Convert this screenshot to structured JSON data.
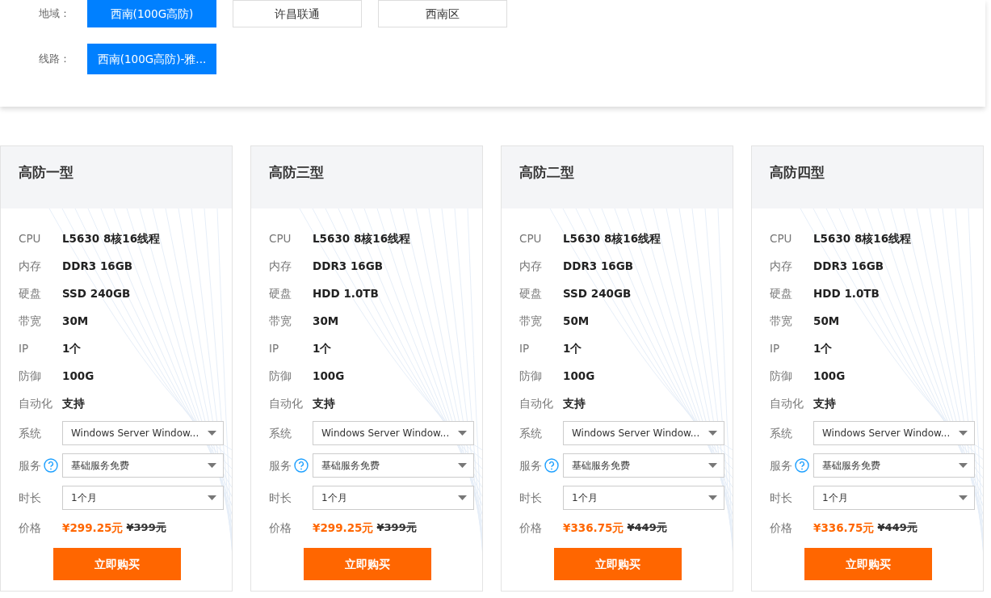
{
  "filters": [
    {
      "label": "地域：",
      "options": [
        {
          "text": "西南(100G高防)",
          "selected": true
        },
        {
          "text": "许昌联通",
          "selected": false
        },
        {
          "text": "西南区",
          "selected": false
        }
      ]
    },
    {
      "label": "线路：",
      "options": [
        {
          "text": "西南(100G高防)-雅...",
          "selected": true
        }
      ]
    }
  ],
  "plans": [
    {
      "title": "高防一型",
      "specs": [
        {
          "label": "CPU",
          "value": "L5630 8核16线程"
        },
        {
          "label": "内存",
          "value": "DDR3 16GB"
        },
        {
          "label": "硬盘",
          "value": "SSD 240GB"
        },
        {
          "label": "带宽",
          "value": "30M"
        },
        {
          "label": "IP",
          "value": "1个"
        },
        {
          "label": "防御",
          "value": "100G"
        },
        {
          "label": "自动化",
          "value": "支持"
        }
      ],
      "selects": [
        {
          "label": "系统",
          "value": "Windows Server Window...",
          "help": false
        },
        {
          "label": "服务",
          "value": "基础服务免费",
          "help": true
        },
        {
          "label": "时长",
          "value": "1个月",
          "help": false
        }
      ],
      "price_label": "价格",
      "price": "¥299.25元",
      "original_price": "¥399元",
      "buy": "立即购买"
    },
    {
      "title": "高防三型",
      "specs": [
        {
          "label": "CPU",
          "value": "L5630 8核16线程"
        },
        {
          "label": "内存",
          "value": "DDR3 16GB"
        },
        {
          "label": "硬盘",
          "value": "HDD 1.0TB"
        },
        {
          "label": "带宽",
          "value": "30M"
        },
        {
          "label": "IP",
          "value": "1个"
        },
        {
          "label": "防御",
          "value": "100G"
        },
        {
          "label": "自动化",
          "value": "支持"
        }
      ],
      "selects": [
        {
          "label": "系统",
          "value": "Windows Server Window...",
          "help": false
        },
        {
          "label": "服务",
          "value": "基础服务免费",
          "help": true
        },
        {
          "label": "时长",
          "value": "1个月",
          "help": false
        }
      ],
      "price_label": "价格",
      "price": "¥299.25元",
      "original_price": "¥399元",
      "buy": "立即购买"
    },
    {
      "title": "高防二型",
      "specs": [
        {
          "label": "CPU",
          "value": "L5630 8核16线程"
        },
        {
          "label": "内存",
          "value": "DDR3 16GB"
        },
        {
          "label": "硬盘",
          "value": "SSD 240GB"
        },
        {
          "label": "带宽",
          "value": "50M"
        },
        {
          "label": "IP",
          "value": "1个"
        },
        {
          "label": "防御",
          "value": "100G"
        },
        {
          "label": "自动化",
          "value": "支持"
        }
      ],
      "selects": [
        {
          "label": "系统",
          "value": "Windows Server Window...",
          "help": false
        },
        {
          "label": "服务",
          "value": "基础服务免费",
          "help": true
        },
        {
          "label": "时长",
          "value": "1个月",
          "help": false
        }
      ],
      "price_label": "价格",
      "price": "¥336.75元",
      "original_price": "¥449元",
      "buy": "立即购买"
    },
    {
      "title": "高防四型",
      "specs": [
        {
          "label": "CPU",
          "value": "L5630 8核16线程"
        },
        {
          "label": "内存",
          "value": "DDR3 16GB"
        },
        {
          "label": "硬盘",
          "value": "HDD 1.0TB"
        },
        {
          "label": "带宽",
          "value": "50M"
        },
        {
          "label": "IP",
          "value": "1个"
        },
        {
          "label": "防御",
          "value": "100G"
        },
        {
          "label": "自动化",
          "value": "支持"
        }
      ],
      "selects": [
        {
          "label": "系统",
          "value": "Windows Server Window...",
          "help": false
        },
        {
          "label": "服务",
          "value": "基础服务免费",
          "help": true
        },
        {
          "label": "时长",
          "value": "1个月",
          "help": false
        }
      ],
      "price_label": "价格",
      "price": "¥336.75元",
      "original_price": "¥449元",
      "buy": "立即购买"
    }
  ]
}
